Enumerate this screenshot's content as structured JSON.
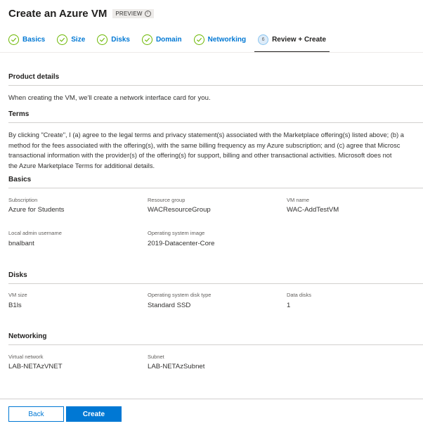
{
  "header": {
    "title": "Create an Azure VM",
    "badge": "PREVIEW"
  },
  "steps": [
    {
      "label": "Basics",
      "state": "complete"
    },
    {
      "label": "Size",
      "state": "complete"
    },
    {
      "label": "Disks",
      "state": "complete"
    },
    {
      "label": "Domain",
      "state": "complete"
    },
    {
      "label": "Networking",
      "state": "complete"
    },
    {
      "label": "Review + Create",
      "state": "active",
      "number": "6"
    }
  ],
  "product_details": {
    "title": "Product details",
    "text": "When creating the VM, we'll create a network interface card for you."
  },
  "terms": {
    "title": "Terms",
    "lines": [
      "By clicking \"Create\", I (a) agree to the legal terms and privacy statement(s) associated with the Marketplace offering(s) listed above; (b) a",
      "method for the fees associated with the offering(s), with the same billing frequency as my Azure subscription; and (c) agree that Microsc",
      "transactional information with the provider(s) of the offering(s) for support, billing and other transactional activities. Microsoft does not",
      "the Azure Marketplace Terms for additional details."
    ]
  },
  "basics": {
    "title": "Basics",
    "subscription_label": "Subscription",
    "subscription_value": "Azure for Students",
    "resource_group_label": "Resource group",
    "resource_group_value": "WACResourceGroup",
    "vm_name_label": "VM name",
    "vm_name_value": "WAC-AddTestVM",
    "admin_label": "Local admin username",
    "admin_value": "bnalbant",
    "os_image_label": "Operating system image",
    "os_image_value": "2019-Datacenter-Core"
  },
  "disks": {
    "title": "Disks",
    "vm_size_label": "VM size",
    "vm_size_value": "B1ls",
    "os_disk_label": "Operating system disk type",
    "os_disk_value": "Standard SSD",
    "data_disks_label": "Data disks",
    "data_disks_value": "1"
  },
  "networking": {
    "title": "Networking",
    "vnet_label": "Virtual network",
    "vnet_value": "LAB-NETAzVNET",
    "subnet_label": "Subnet",
    "subnet_value": "LAB-NETAzSubnet"
  },
  "footer": {
    "back_label": "Back",
    "create_label": "Create"
  },
  "colors": {
    "accent": "#0078d4",
    "success": "#6bb700"
  },
  "icons": {
    "complete_step": "checkmark-icon",
    "preview_info": "info-icon"
  }
}
